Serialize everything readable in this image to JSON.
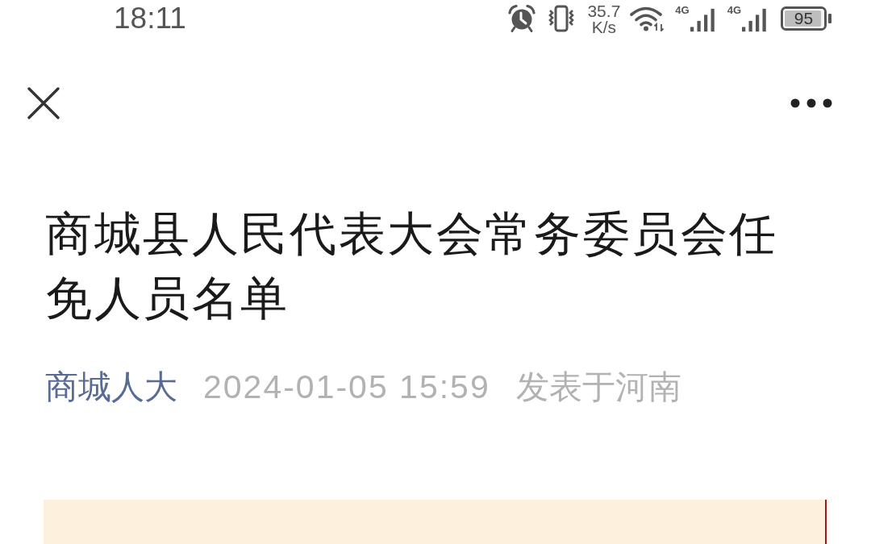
{
  "status_bar": {
    "time": "18:11",
    "net_speed": {
      "value": "35.7",
      "unit": "K/s"
    },
    "networks": [
      {
        "type": "4G"
      },
      {
        "type": "4G"
      }
    ],
    "battery": {
      "text": "95",
      "level": 0.95
    }
  },
  "article": {
    "title": "商城县人民代表大会常务委员会任免人员名单",
    "account": "商城人大",
    "date": "2024-01-05 15:59",
    "location": "发表于河南"
  }
}
